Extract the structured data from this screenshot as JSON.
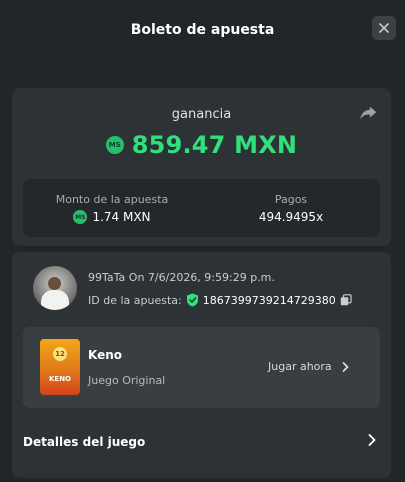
{
  "header": {
    "title": "Boleto de apuesta"
  },
  "payout": {
    "label": "ganancia",
    "currency_icon": "MS",
    "amount": "859.47 MXN",
    "bet_amount_label": "Monto de la apuesta",
    "bet_amount": "1.74 MXN",
    "payout_label": "Pagos",
    "payout_value": "494.9495x"
  },
  "bet": {
    "user": "99TaTa",
    "date_text": "On 7/6/2026, 9:59:29 p.m.",
    "id_label": "ID de la apuesta:",
    "id_value": "1867399739214729380"
  },
  "game": {
    "name": "Keno",
    "subtitle": "Juego Original",
    "play_label": "Jugar ahora",
    "thumb_number": "12",
    "thumb_label": "KENO"
  },
  "details": {
    "label": "Detalles del juego"
  },
  "colors": {
    "accent_green": "#2fe07c",
    "background": "#222628",
    "card": "#2d3235"
  }
}
